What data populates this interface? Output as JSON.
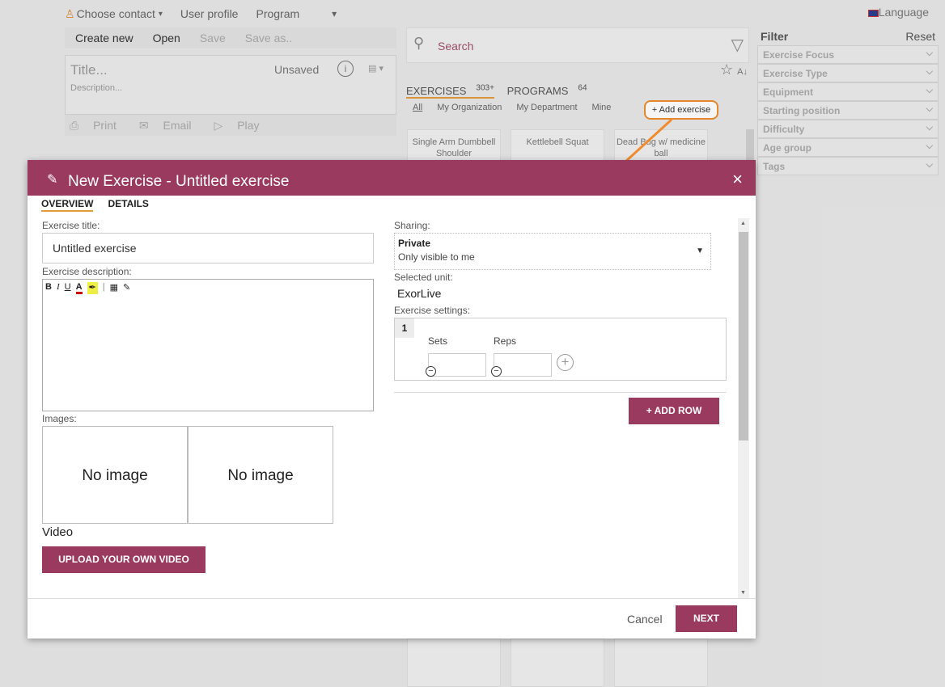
{
  "topbar": {
    "contact": "Choose contact",
    "contact_caret": "▾",
    "profile": "User profile",
    "program": "Program",
    "program_caret": "▾",
    "language": "Language"
  },
  "toolbar": {
    "create_new": "Create new",
    "open": "Open",
    "save": "Save",
    "save_as": "Save as.."
  },
  "program_box": {
    "title_placeholder": "Title...",
    "status": "Unsaved",
    "info_icon": "i",
    "description_placeholder": "Description..."
  },
  "actions": {
    "print": "Print",
    "email": "Email",
    "play": "Play"
  },
  "search": {
    "placeholder": "Search"
  },
  "library_tabs": {
    "exercises": "EXERCISES",
    "exercises_count": "303+",
    "programs": "PROGRAMS",
    "programs_count": "64"
  },
  "library_subtabs": [
    "All",
    "My Organization",
    "My Department",
    "Mine"
  ],
  "add_exercise": "+ Add exercise",
  "cards": [
    "Single Arm Dumbbell Shoulder",
    "Kettlebell Squat",
    "Dead Bug w/ medicine ball"
  ],
  "filter": {
    "title": "Filter",
    "reset": "Reset",
    "items": [
      "Exercise Focus",
      "Exercise Type",
      "Equipment",
      "Starting position",
      "Difficulty",
      "Age group",
      "Tags"
    ]
  },
  "modal": {
    "title": "New Exercise - Untitled exercise",
    "close": "×",
    "tabs": {
      "overview": "OVERVIEW",
      "details": "DETAILS"
    },
    "exercise_title_label": "Exercise title:",
    "exercise_title_value": "Untitled exercise",
    "description_label": "Exercise description:",
    "images_label": "Images:",
    "no_image_1": "No image",
    "no_image_2": "No image",
    "video_label": "Video",
    "upload_video": "UPLOAD YOUR OWN VIDEO",
    "sharing_label": "Sharing:",
    "sharing_value": "Private",
    "sharing_desc": "Only visible to me",
    "sharing_caret": "▼",
    "unit_label": "Selected unit:",
    "unit_value": "ExorLive",
    "settings_label": "Exercise settings:",
    "row_number": "1",
    "sets_label": "Sets",
    "reps_label": "Reps",
    "add_row": "+ ADD ROW",
    "cancel": "Cancel",
    "next": "NEXT"
  },
  "colors": {
    "brand": "#9a3a5e",
    "accent": "#f08c2e"
  }
}
